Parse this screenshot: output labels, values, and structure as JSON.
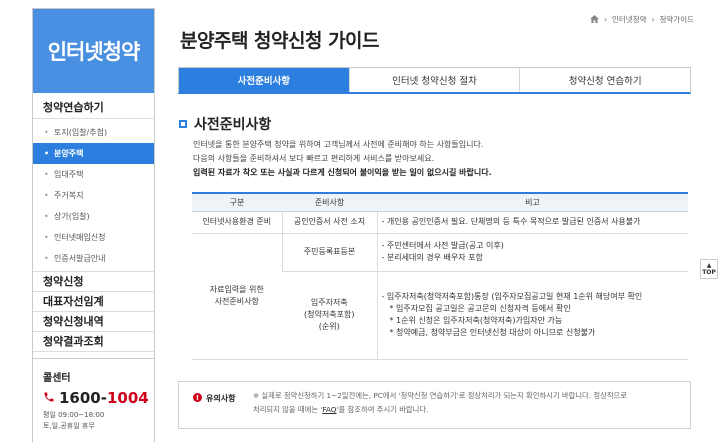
{
  "sidebar": {
    "header": "인터넷청약",
    "main_items": [
      {
        "label": "청약연습하기"
      },
      {
        "label": "청약신청"
      },
      {
        "label": "대표자선임계"
      },
      {
        "label": "청약신청내역"
      },
      {
        "label": "청약결과조회"
      }
    ],
    "sub_items": [
      {
        "label": "토지(입찰/추첨)",
        "active": false
      },
      {
        "label": "분양주택",
        "active": true
      },
      {
        "label": "임대주택",
        "active": false
      },
      {
        "label": "주거복지",
        "active": false
      },
      {
        "label": "상가(입찰)",
        "active": false
      },
      {
        "label": "인터넷매입신청",
        "active": false
      },
      {
        "label": "인증서발급안내",
        "active": false
      }
    ],
    "call_center": {
      "title": "콜센터",
      "number_prefix": "1600-",
      "number_suffix": "1004",
      "hours_weekday": "평일 09:00~18:00",
      "hours_weekend": "토,일,공휴일 휴무"
    }
  },
  "breadcrumb": [
    "인터넷청약",
    "청약가이드"
  ],
  "page_title": "분양주택 청약신청 가이드",
  "tabs": [
    {
      "label": "사전준비사항",
      "active": true
    },
    {
      "label": "인터넷 청약신청 절차",
      "active": false
    },
    {
      "label": "청약신청 연습하기",
      "active": false
    }
  ],
  "section": {
    "title": "사전준비사항",
    "intro_1": "인터넷을 통한 분양주택 청약을 위하여 고객님께서 사전에 준비해야 하는 사항들입니다.",
    "intro_2": "다음의 사항들을 준비하셔서 보다 빠르고 편리하게 서비스를 받아보세요.",
    "intro_bold": "입력된 자료가 착오 또는 사실과 다르게 신청되어 불이익을 받는 일이 없으시길 바랍니다."
  },
  "table": {
    "headers": [
      "구분",
      "준비사항",
      "비고"
    ],
    "row1": {
      "category": "인터넷사용환경 준비",
      "item": "공인인증서 사전 소지",
      "note": "- 개인용 공인인증서 필요. 단체명의 등 특수 목적으로 발급된 인증서 사용불가"
    },
    "row2": {
      "category_1": "자료입력을 위한",
      "category_2": "사전준비사항",
      "item": "주민등록표등본",
      "note_1": "- 주민센터에서 사전 발급(공고 이후)",
      "note_2": "- 분리세대의 경우 배우자 포함"
    },
    "row3": {
      "item_1": "입주자저축",
      "item_2": "(청약저축포함)",
      "item_3": "(순위)",
      "note_1": "- 입주자저축(청약저축포함)통장 (입주자모집공고일 현재 1순위 해당여부 확인",
      "note_2": "* 입주자모집 공고일은 공고문의 신청자격 등에서 확인",
      "note_3": "* 1순위 신청은 입주자저축(청약저축)가입자만 가능",
      "note_4": "* 청약예금, 청약부금은 인터넷신청 대상이 아니므로 신청불가"
    }
  },
  "notice": {
    "title": "유의사항",
    "line_1": "※ 실제로 청약신청하기 1~2일전에는, PC에서 '청약신청 연습하기'로 정상처리가 되는지 확인하시기 바랍니다. 정상적으로",
    "line_2_pre": "처리되지 않을 때에는 '",
    "line_2_link": "FAQ",
    "line_2_post": "'를 참조하여 주시기 바랍니다."
  },
  "top_button": "TOP",
  "colors": {
    "accent": "#2c7fdf",
    "header_bg": "#4a90e2",
    "highlight": "#d0021b"
  }
}
